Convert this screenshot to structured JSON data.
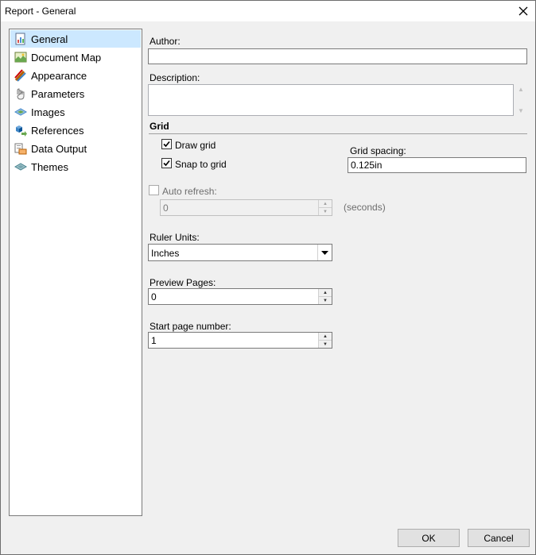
{
  "window": {
    "title": "Report - General"
  },
  "sidebar": {
    "items": [
      {
        "label": "General",
        "icon": "report-icon",
        "selected": true
      },
      {
        "label": "Document Map",
        "icon": "document-map-icon"
      },
      {
        "label": "Appearance",
        "icon": "appearance-icon"
      },
      {
        "label": "Parameters",
        "icon": "parameters-icon"
      },
      {
        "label": "Images",
        "icon": "images-icon"
      },
      {
        "label": "References",
        "icon": "references-icon"
      },
      {
        "label": "Data Output",
        "icon": "data-output-icon"
      },
      {
        "label": "Themes",
        "icon": "themes-icon"
      }
    ]
  },
  "form": {
    "author_label": "Author:",
    "author_value": "",
    "description_label": "Description:",
    "description_value": "",
    "grid_title": "Grid",
    "draw_grid_label": "Draw grid",
    "draw_grid_checked": true,
    "snap_to_grid_label": "Snap to grid",
    "snap_to_grid_checked": true,
    "grid_spacing_label": "Grid spacing:",
    "grid_spacing_value": "0.125in",
    "auto_refresh_label": "Auto refresh:",
    "auto_refresh_checked": false,
    "auto_refresh_value": "0",
    "seconds_label": "(seconds)",
    "ruler_units_label": "Ruler Units:",
    "ruler_units_value": "Inches",
    "preview_pages_label": "Preview Pages:",
    "preview_pages_value": "0",
    "start_page_label": "Start page number:",
    "start_page_value": "1"
  },
  "buttons": {
    "ok": "OK",
    "cancel": "Cancel"
  },
  "colors": {
    "selection": "#cce8ff",
    "dialog_bg": "#f0f0f0"
  }
}
